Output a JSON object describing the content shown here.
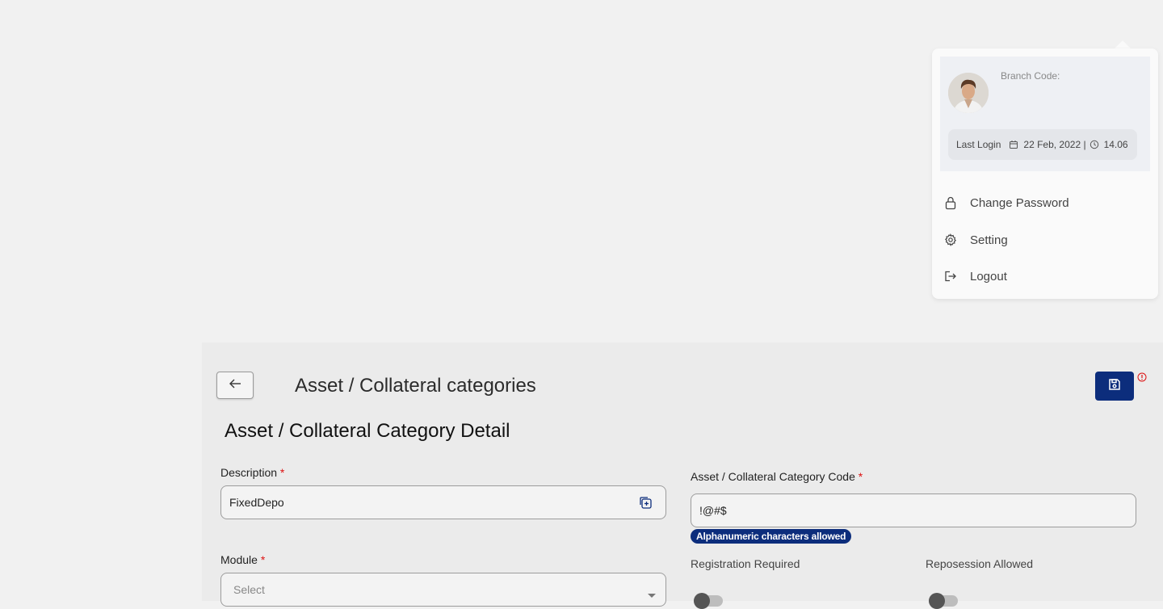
{
  "header": {
    "back_label": "",
    "page_title": "Asset / Collateral categories"
  },
  "section_title": "Asset / Collateral Category Detail",
  "form": {
    "description": {
      "label": "Description",
      "required": "*",
      "value": "FixedDepo"
    },
    "category_code": {
      "label": "Asset / Collateral Category Code",
      "required": "*",
      "value": "!@#$",
      "hint": "Alphanumeric characters allowed"
    },
    "module": {
      "label": "Module",
      "required": "*",
      "placeholder": "Select"
    },
    "registration_required": {
      "label": "Registration Required"
    },
    "repossession_allowed": {
      "label": "Reposession Allowed"
    }
  },
  "user_menu": {
    "branch_code_label": "Branch Code:",
    "last_login_label": "Last Login",
    "last_login_date": "22 Feb, 2022 |",
    "last_login_time": "14.06",
    "items": [
      {
        "label": "Change Password",
        "icon": "lock-icon"
      },
      {
        "label": "Setting",
        "icon": "gear-icon"
      },
      {
        "label": "Logout",
        "icon": "logout-icon"
      }
    ]
  },
  "colors": {
    "primary": "#0c2d7c",
    "required": "#dd1111",
    "error": "#dd1111"
  }
}
